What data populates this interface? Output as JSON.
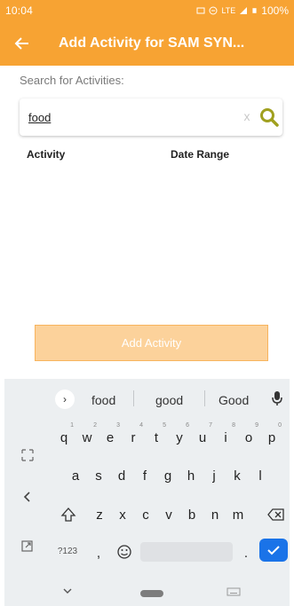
{
  "status_bar": {
    "time": "10:04",
    "network": "LTE",
    "battery": "100%"
  },
  "app_bar": {
    "back_icon": "arrow-left-icon",
    "title": "Add Activity for SAM SYN..."
  },
  "search": {
    "label": "Search for Activities:",
    "value": "food",
    "clear_icon": "x",
    "search_icon": "magnifier-icon"
  },
  "table": {
    "col_activity": "Activity",
    "col_date_range": "Date Range"
  },
  "add_button": {
    "label": "Add Activity"
  },
  "keyboard": {
    "suggestions": [
      "food",
      "good",
      "Good"
    ],
    "row1": [
      "q",
      "w",
      "e",
      "r",
      "t",
      "y",
      "u",
      "i",
      "o",
      "p"
    ],
    "row1_hints": [
      "1",
      "2",
      "3",
      "4",
      "5",
      "6",
      "7",
      "8",
      "9",
      "0"
    ],
    "row2": [
      "a",
      "s",
      "d",
      "f",
      "g",
      "h",
      "j",
      "k",
      "l"
    ],
    "row3": [
      "z",
      "x",
      "c",
      "v",
      "b",
      "n",
      "m"
    ],
    "num_label": "?123",
    "comma": ",",
    "period": "."
  },
  "colors": {
    "accent": "#f7a333",
    "button_disabled": "#fcd29b",
    "search_icon": "#a0a01f",
    "enter_key": "#1a73e8"
  }
}
